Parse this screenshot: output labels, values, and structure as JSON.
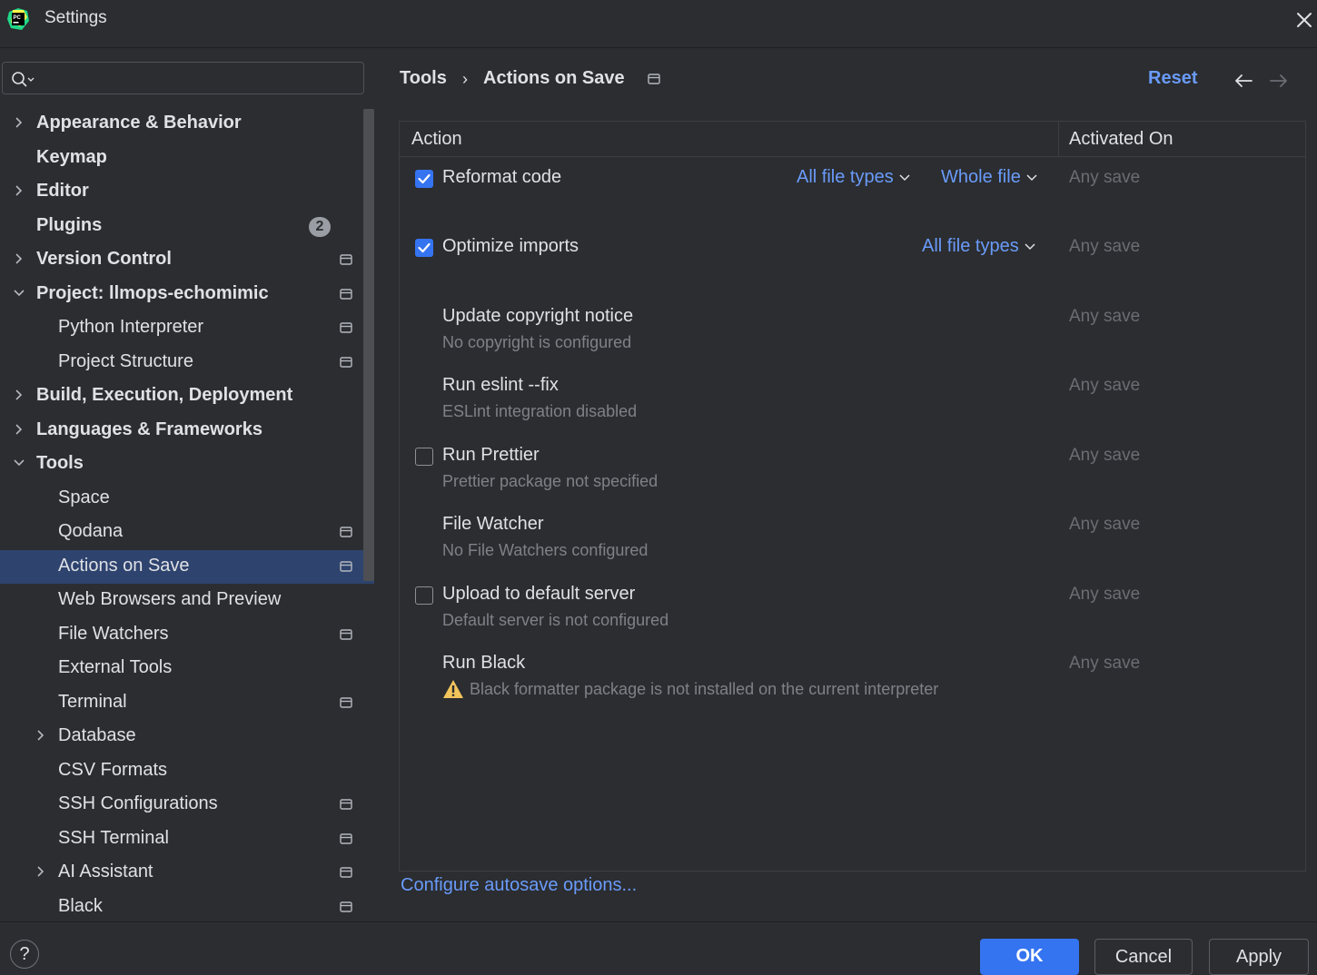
{
  "window": {
    "title": "Settings",
    "logo_icon": "pycharm-logo-icon",
    "close_icon": "close-icon"
  },
  "sidebar": {
    "search": {
      "value": "",
      "placeholder": "",
      "icon": "search-icon"
    },
    "items": [
      {
        "label": "Appearance & Behavior",
        "bold": true,
        "expandable": true,
        "expanded": false,
        "level": 0
      },
      {
        "label": "Keymap",
        "bold": true,
        "level": 0
      },
      {
        "label": "Editor",
        "bold": true,
        "expandable": true,
        "expanded": false,
        "level": 0
      },
      {
        "label": "Plugins",
        "bold": true,
        "level": 0,
        "badge": "2"
      },
      {
        "label": "Version Control",
        "bold": true,
        "expandable": true,
        "expanded": false,
        "level": 0,
        "project": true
      },
      {
        "label": "Project: llmops-echomimic",
        "bold": true,
        "expandable": true,
        "expanded": true,
        "level": 0,
        "project": true
      },
      {
        "label": "Python Interpreter",
        "level": 1,
        "project": true
      },
      {
        "label": "Project Structure",
        "level": 1,
        "project": true
      },
      {
        "label": "Build, Execution, Deployment",
        "bold": true,
        "expandable": true,
        "expanded": false,
        "level": 0
      },
      {
        "label": "Languages & Frameworks",
        "bold": true,
        "expandable": true,
        "expanded": false,
        "level": 0
      },
      {
        "label": "Tools",
        "bold": true,
        "expandable": true,
        "expanded": true,
        "level": 0
      },
      {
        "label": "Space",
        "level": 1
      },
      {
        "label": "Qodana",
        "level": 1,
        "project": true
      },
      {
        "label": "Actions on Save",
        "level": 1,
        "project": true,
        "selected": true
      },
      {
        "label": "Web Browsers and Preview",
        "level": 1
      },
      {
        "label": "File Watchers",
        "level": 1,
        "project": true
      },
      {
        "label": "External Tools",
        "level": 1
      },
      {
        "label": "Terminal",
        "level": 1,
        "project": true
      },
      {
        "label": "Database",
        "level": 1,
        "expandable": true,
        "expanded": false
      },
      {
        "label": "CSV Formats",
        "level": 1
      },
      {
        "label": "SSH Configurations",
        "level": 1,
        "project": true
      },
      {
        "label": "SSH Terminal",
        "level": 1,
        "project": true
      },
      {
        "label": "AI Assistant",
        "level": 1,
        "expandable": true,
        "expanded": false,
        "project": true
      },
      {
        "label": "Black",
        "level": 1,
        "project": true
      }
    ]
  },
  "header": {
    "breadcrumb": [
      "Tools",
      "Actions on Save"
    ],
    "separator": "›",
    "reset_label": "Reset",
    "back_icon": "arrow-left-icon",
    "forward_icon": "arrow-right-icon"
  },
  "table": {
    "columns": [
      "Action",
      "Activated On"
    ],
    "rows": [
      {
        "title": "Reformat code",
        "subtitle": "",
        "checkbox": "checked",
        "dropdowns": [
          "All file types",
          "Whole file"
        ],
        "activated_on": "Any save"
      },
      {
        "title": "Optimize imports",
        "subtitle": "",
        "checkbox": "checked",
        "dropdowns": [
          "All file types"
        ],
        "activated_on": "Any save"
      },
      {
        "title": "Update copyright notice",
        "subtitle": "No copyright is configured",
        "checkbox": "none",
        "dropdowns": [],
        "activated_on": "Any save"
      },
      {
        "title": "Run eslint --fix",
        "subtitle": "ESLint integration disabled",
        "checkbox": "none",
        "dropdowns": [],
        "activated_on": "Any save"
      },
      {
        "title": "Run Prettier",
        "subtitle": "Prettier package not specified",
        "checkbox": "unchecked",
        "dropdowns": [],
        "activated_on": "Any save"
      },
      {
        "title": "File Watcher",
        "subtitle": "No File Watchers configured",
        "checkbox": "none",
        "dropdowns": [],
        "activated_on": "Any save"
      },
      {
        "title": "Upload to default server",
        "subtitle": "Default server is not configured",
        "checkbox": "unchecked",
        "dropdowns": [],
        "activated_on": "Any save"
      },
      {
        "title": "Run Black",
        "subtitle": "Black formatter package is not installed on the current interpreter",
        "checkbox": "none",
        "warning": true,
        "dropdowns": [],
        "activated_on": "Any save"
      }
    ]
  },
  "autosave_link": "Configure autosave options...",
  "footer": {
    "help_label": "?",
    "ok_label": "OK",
    "cancel_label": "Cancel",
    "apply_label": "Apply"
  },
  "colors": {
    "background": "#2b2d30",
    "accent": "#3574f0",
    "link": "#6a9bfa",
    "selection": "#2e436e",
    "muted_text": "#7e8187",
    "warning": "#f2c55c"
  }
}
